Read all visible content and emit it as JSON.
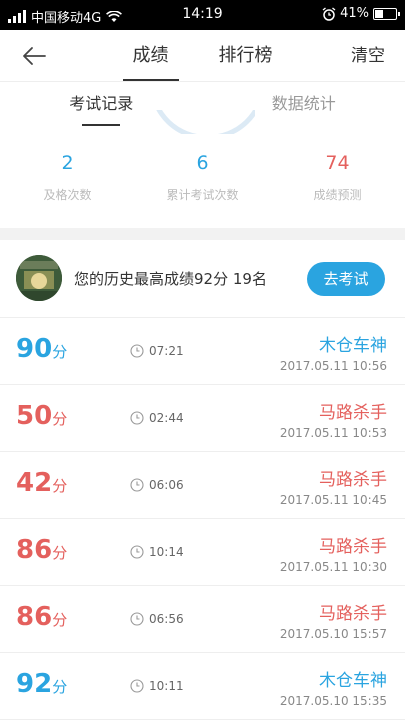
{
  "status_bar": {
    "carrier": "中国移动4G",
    "time": "14:19",
    "battery_percent": "41%",
    "battery_level": 0.41
  },
  "nav": {
    "tabs": [
      {
        "label": "成绩",
        "active": true
      },
      {
        "label": "排行榜",
        "active": false
      }
    ],
    "clear_label": "清空"
  },
  "sub_tabs": [
    {
      "label": "考试记录",
      "active": true
    },
    {
      "label": "数据统计",
      "active": false
    }
  ],
  "stats": [
    {
      "value": "2",
      "label": "及格次数",
      "color": "#2aa4e0"
    },
    {
      "value": "6",
      "label": "累计考试次数",
      "color": "#2aa4e0"
    },
    {
      "value": "74",
      "label": "成绩预测",
      "color": "#e4605d"
    }
  ],
  "best": {
    "text": "您的历史最高成绩92分  19名",
    "button_label": "去考试"
  },
  "score_unit": "分",
  "records": [
    {
      "score": "90",
      "duration": "07:21",
      "title": "木仓车神",
      "date": "2017.05.11   10:56",
      "color": "blue"
    },
    {
      "score": "50",
      "duration": "02:44",
      "title": "马路杀手",
      "date": "2017.05.11   10:53",
      "color": "red"
    },
    {
      "score": "42",
      "duration": "06:06",
      "title": "马路杀手",
      "date": "2017.05.11   10:45",
      "color": "red"
    },
    {
      "score": "86",
      "duration": "10:14",
      "title": "马路杀手",
      "date": "2017.05.11   10:30",
      "color": "red"
    },
    {
      "score": "86",
      "duration": "06:56",
      "title": "马路杀手",
      "date": "2017.05.10   15:57",
      "color": "red"
    },
    {
      "score": "92",
      "duration": "10:11",
      "title": "木仓车神",
      "date": "2017.05.10   15:35",
      "color": "blue"
    }
  ]
}
